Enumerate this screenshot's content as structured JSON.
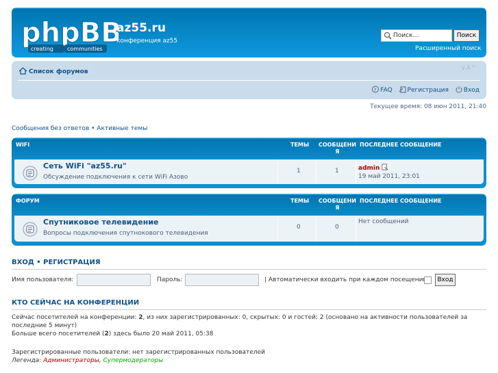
{
  "header": {
    "logo_text": "phpBB",
    "logo_tagline_1": "creating",
    "logo_tagline_2": "communities",
    "site_name": "az55.ru",
    "site_description": "конференция az55",
    "search_placeholder": "Поиск…",
    "search_button": "Поиск",
    "advanced_search": "Расширенный поиск"
  },
  "navbar": {
    "forum_list": "Список форумов",
    "font_size": "∨A^",
    "faq": "FAQ",
    "register": "Регистрация",
    "login": "Вход"
  },
  "current_time": "Текущее время: 08 июн 2011, 21:40",
  "quick_links": {
    "unanswered": "Сообщения без ответов",
    "separator": " • ",
    "active": "Активные темы"
  },
  "columns": {
    "topics": "ТЕМЫ",
    "posts_line1": "СООБЩЕНИ",
    "posts_line2": "Я",
    "last_post": "ПОСЛЕДНЕЕ СООБЩЕНИЕ"
  },
  "categories": [
    {
      "name": "WIFI",
      "forum": {
        "title": "Сеть WiFi \"az55.ru\"",
        "description": "Обсуждение подключения к сети WiFi Азово",
        "topics": "1",
        "posts": "1",
        "last_author": "admin",
        "last_date": "19 май 2011, 23:01"
      }
    },
    {
      "name": "ФОРУМ",
      "forum": {
        "title": "Спутниковое телевидение",
        "description": "Вопросы подключения спутнокового телевидения",
        "topics": "0",
        "posts": "0",
        "last_empty": "Нет сообщений"
      }
    }
  ],
  "login": {
    "title_login": "ВХОД",
    "title_sep": " • ",
    "title_register": "РЕГИСТРАЦИЯ",
    "username_label": "Имя пользователя:",
    "password_label": "Пароль:",
    "autologin_label": "| Автоматически входить при каждом посещении",
    "button": "Вход"
  },
  "online": {
    "title": "КТО СЕЙЧАС НА КОНФЕРЕНЦИИ",
    "line1_a": "Сейчас посетителей на конференции: ",
    "line1_count": "2",
    "line1_b": ", из них зарегистрированных: 0, скрытых: 0 и гостей: 2 (основано на активности пользователей за",
    "line2": "последние 5 минут)",
    "line3_a": "Больше всего посетителей (",
    "line3_count": "2",
    "line3_b": ") здесь было 20 май 2011, 05:38",
    "registered": "Зарегистрированные пользователи: нет зарегистрированных пользователей",
    "legend_label": "Легенда: ",
    "legend_admins": "Администраторы",
    "legend_sep": ", ",
    "legend_mods": "Супермодераторы"
  },
  "colors": {
    "header_blue": "#12a3eb",
    "nav_bg": "#cadceb",
    "link": "#105289",
    "admin_red": "#aa0000",
    "mod_green": "#00aa00"
  }
}
